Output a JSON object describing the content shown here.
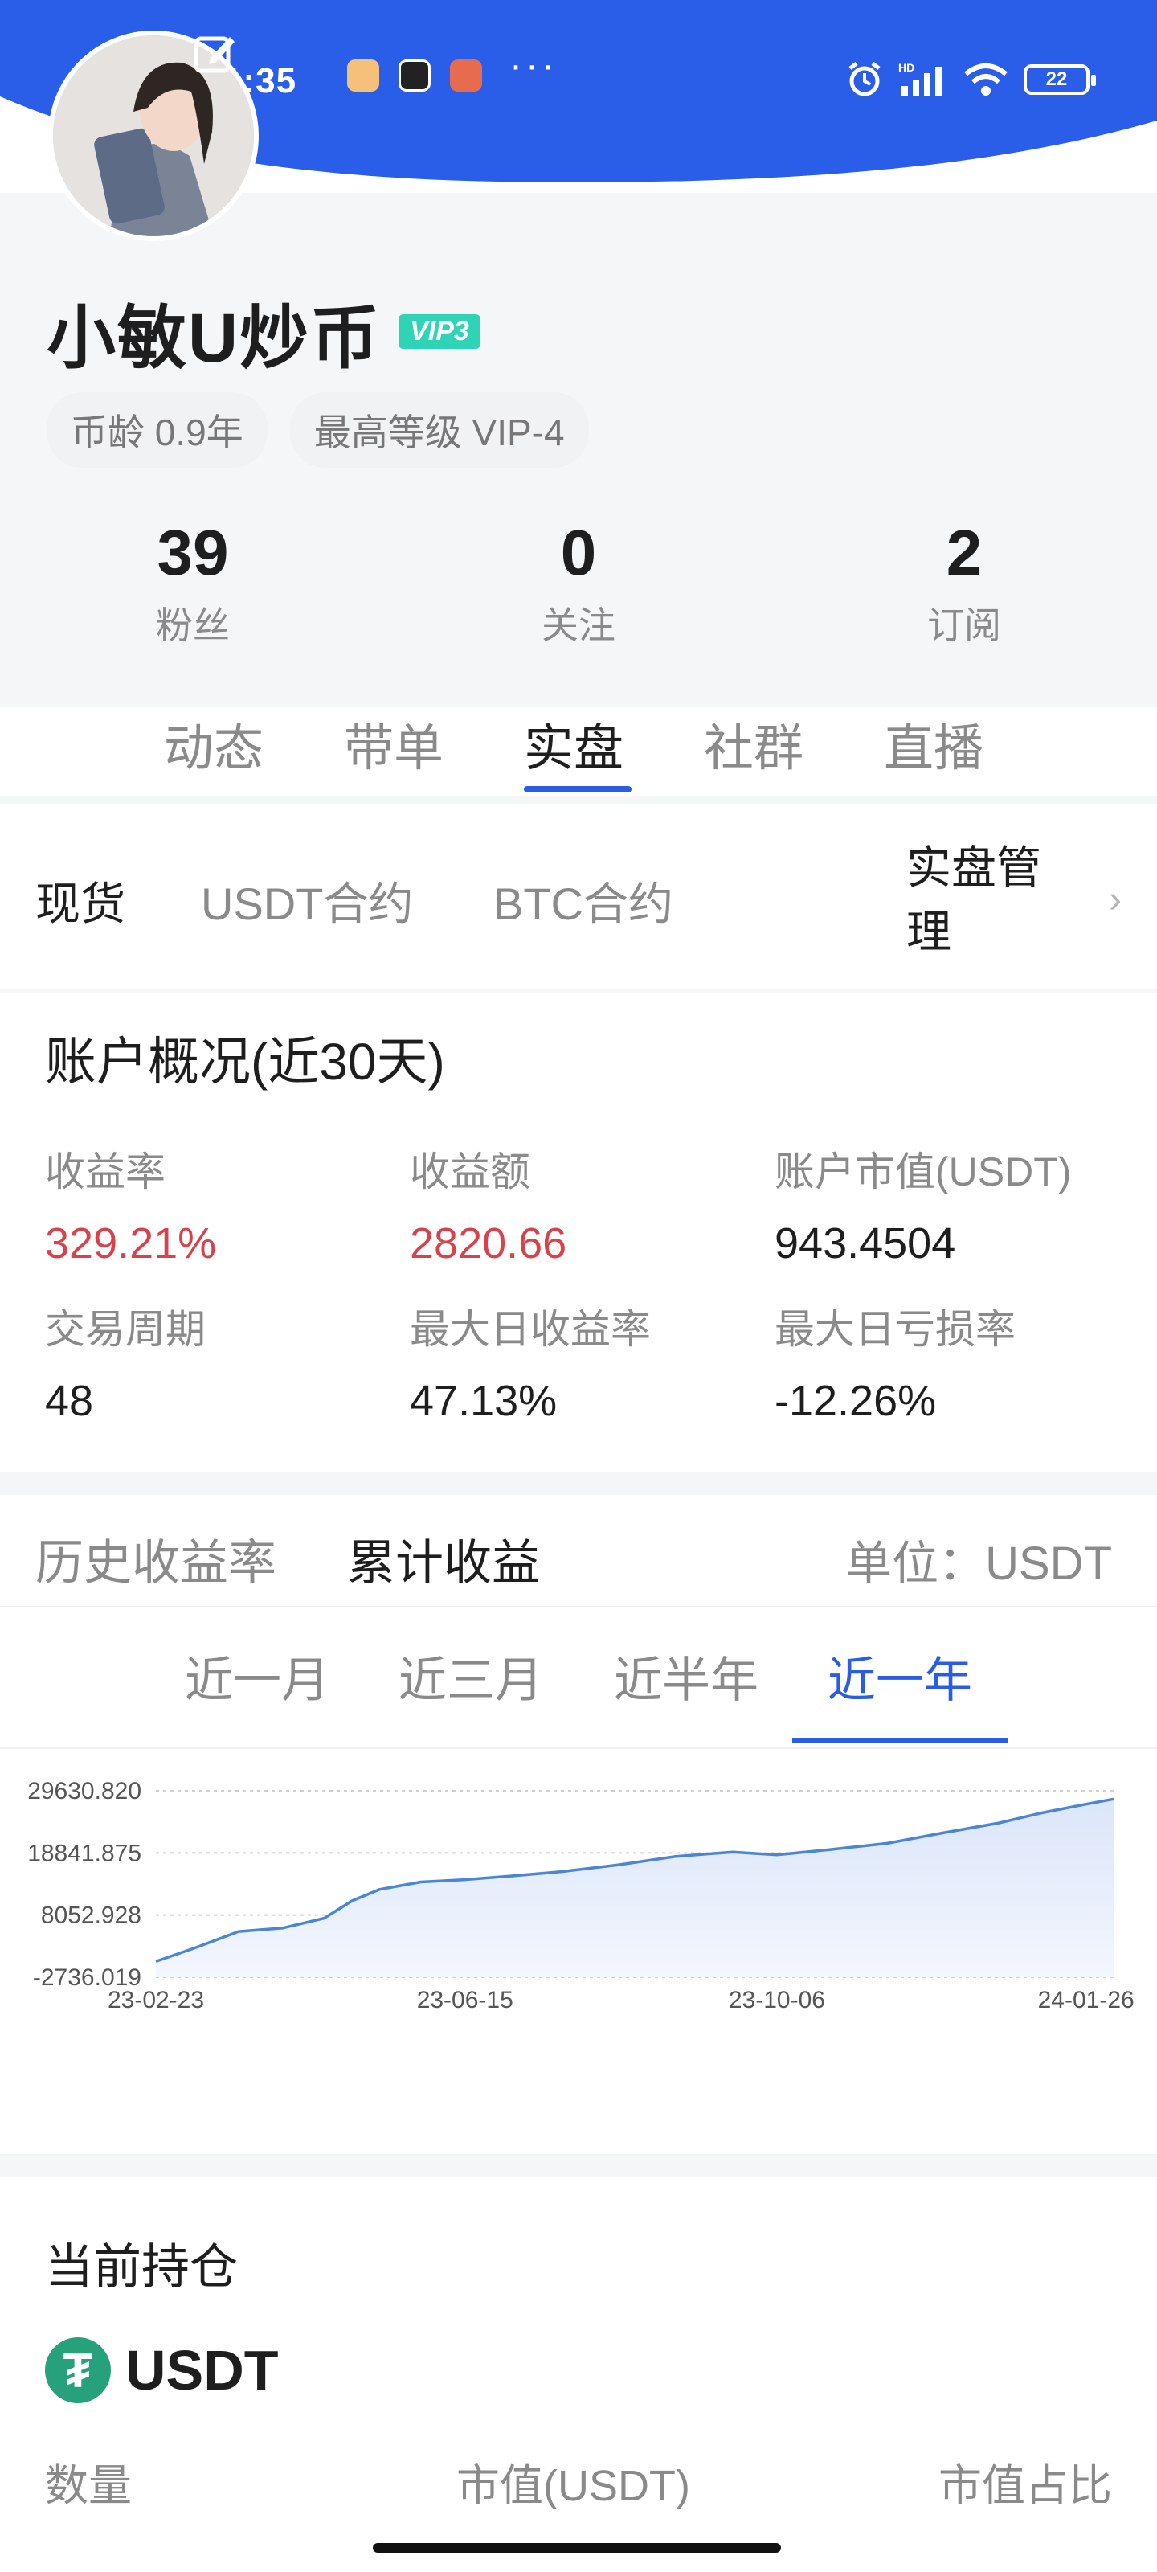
{
  "status_bar": {
    "time": "午1:35",
    "more": "···",
    "battery": "22",
    "network": "HD"
  },
  "profile": {
    "name": "小敏U炒币",
    "vip_badge": "VIP3",
    "chips": [
      "币龄 0.9年",
      "最高等级 VIP-4"
    ],
    "stats": [
      {
        "value": "39",
        "label": "粉丝"
      },
      {
        "value": "0",
        "label": "关注"
      },
      {
        "value": "2",
        "label": "订阅"
      }
    ]
  },
  "main_tabs": [
    "动态",
    "带单",
    "实盘",
    "社群",
    "直播"
  ],
  "active_main_tab": "实盘",
  "sub_tabs": [
    "现货",
    "USDT合约",
    "BTC合约"
  ],
  "manage_label": "实盘管理",
  "overview": {
    "title": "账户概况(近30天)",
    "metrics": [
      {
        "label": "收益率",
        "value": "329.21%",
        "color": "#d9424a"
      },
      {
        "label": "收益额",
        "value": "2820.66",
        "color": "#d9424a"
      },
      {
        "label": "账户市值(USDT)",
        "value": "943.4504"
      },
      {
        "label": "交易周期",
        "value": "48"
      },
      {
        "label": "最大日收益率",
        "value": "47.13%"
      },
      {
        "label": "最大日亏损率",
        "value": "-12.26%"
      }
    ]
  },
  "chart_tabs": [
    "历史收益率",
    "累计收益"
  ],
  "active_chart_tab": "累计收益",
  "unit_label": "单位：USDT",
  "periods": [
    "近一月",
    "近三月",
    "近半年",
    "近一年"
  ],
  "active_period": "近一年",
  "chart_data": {
    "type": "area",
    "title": "",
    "xlabel": "",
    "ylabel": "",
    "y_ticks": [
      "29630.820",
      "18841.875",
      "8052.928",
      "-2736.019"
    ],
    "ylim": [
      -2736.019,
      29630.82
    ],
    "x_ticks": [
      "23-02-23",
      "23-06-15",
      "23-10-06",
      "24-01-26"
    ],
    "x": [
      "23-02-23",
      "23-03-10",
      "23-03-25",
      "23-04-10",
      "23-04-25",
      "23-05-05",
      "23-05-15",
      "23-05-30",
      "23-06-15",
      "23-07-01",
      "23-07-20",
      "23-08-10",
      "23-08-30",
      "23-09-20",
      "23-10-06",
      "23-10-25",
      "23-11-15",
      "23-12-05",
      "23-12-25",
      "24-01-10",
      "24-01-26",
      "24-02-05"
    ],
    "values": [
      0,
      2500,
      5200,
      5800,
      7500,
      10500,
      12500,
      13800,
      14200,
      14800,
      15600,
      16800,
      18200,
      19000,
      18500,
      19400,
      20500,
      22300,
      24000,
      25800,
      27300,
      28200
    ],
    "colors": {
      "line": "#4a86d4",
      "fill_top": "#dbe6fa",
      "fill_bottom": "#f3f6fd"
    }
  },
  "holdings": {
    "title": "当前持仓",
    "coin_symbol": "₮",
    "coin": "USDT",
    "columns": [
      "数量",
      "市值(USDT)",
      "市值占比"
    ]
  },
  "colors": {
    "accent": "#2b5ce6",
    "header_blue": "#2a5de8",
    "profit_red": "#d9424a",
    "vip": "#2fd3b5",
    "tether": "#26a17b"
  }
}
